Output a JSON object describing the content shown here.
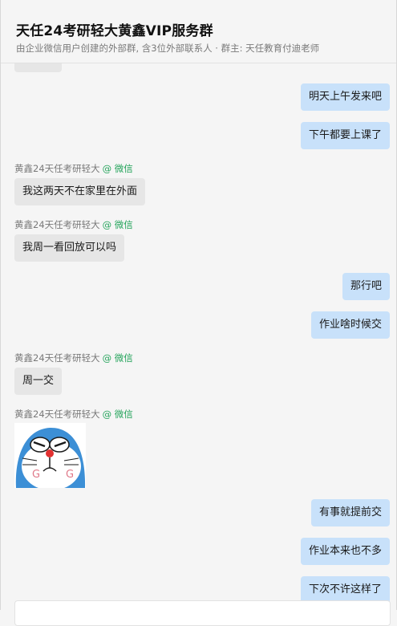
{
  "header": {
    "title": "天任24考研轻大黄鑫VIP服务群",
    "subtitle": "由企业微信用户创建的外部群, 含3位外部联系人 · 群主: 天任教育付迪老师"
  },
  "messages": {
    "m1": "明天上午发来吧",
    "m2": "下午都要上课了",
    "s1_name": "黄鑫24天任考研轻大",
    "s1_tag": "@ 微信",
    "m3": "我这两天不在家里在外面",
    "s2_name": "黄鑫24天任考研轻大",
    "s2_tag": "@ 微信",
    "m4": "我周一看回放可以吗",
    "m5": "那行吧",
    "m6": "作业啥时候交",
    "s3_name": "黄鑫24天任考研轻大",
    "s3_tag": "@ 微信",
    "m7": "周一交",
    "s4_name": "黄鑫24天任考研轻大",
    "s4_tag": "@ 微信",
    "m8": "有事就提前交",
    "m9": "作业本来也不多",
    "m10": "下次不许这样了"
  },
  "colors": {
    "outgoing_bubble": "#c8e1fa",
    "incoming_bubble": "#e6e6e6",
    "wechat_tag": "#23a35a"
  }
}
